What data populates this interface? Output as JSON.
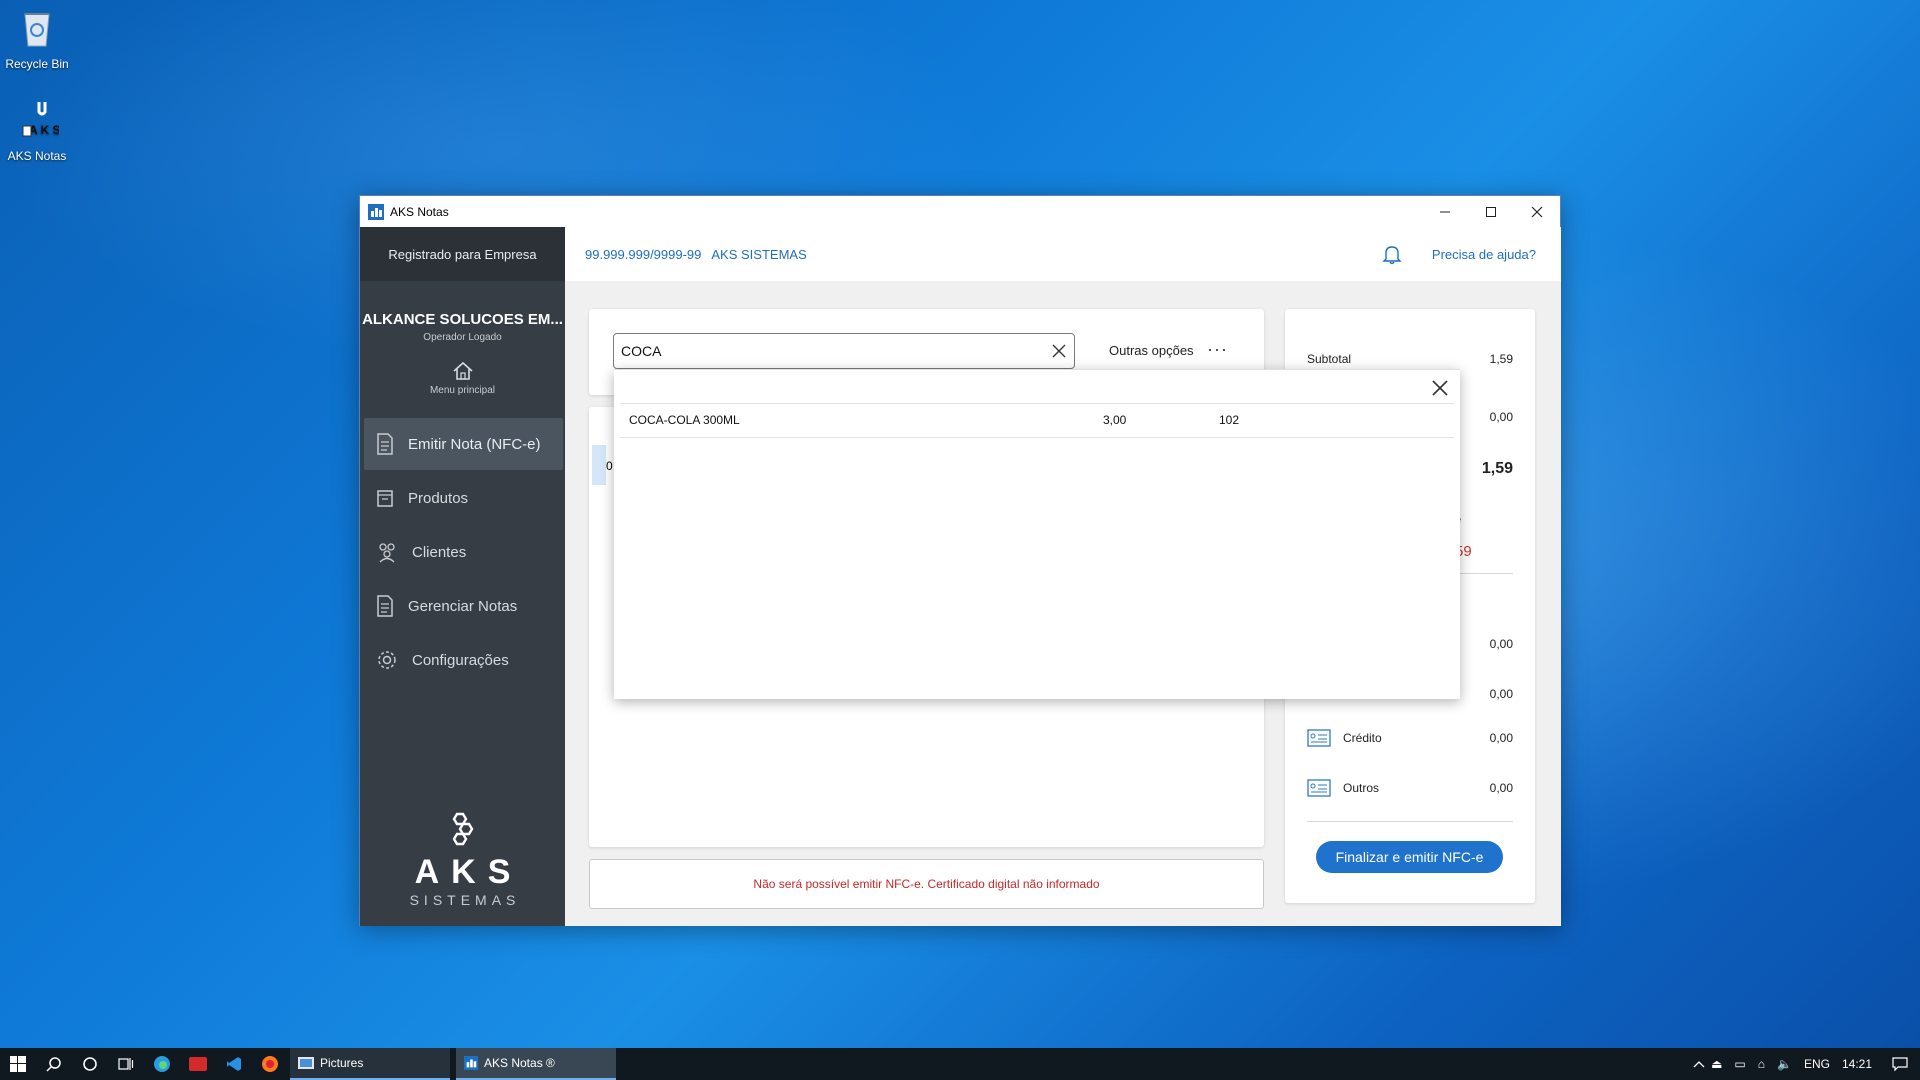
{
  "desktop": {
    "icons": [
      {
        "label": "Recycle Bin"
      },
      {
        "label": "AKS Notas"
      }
    ]
  },
  "window": {
    "title": "AKS Notas",
    "controls": {
      "minimize": "—",
      "maximize": "☐",
      "close": "✕"
    }
  },
  "sidebar": {
    "registered": "Registrado para Empresa",
    "company": "ALKANCE SOLUCOES EM...",
    "operator": "Operador Logado",
    "home": "Menu principal",
    "items": [
      {
        "label": "Emitir Nota (NFC-e)",
        "icon": "document-icon",
        "active": true
      },
      {
        "label": "Produtos",
        "icon": "box-icon"
      },
      {
        "label": "Clientes",
        "icon": "people-icon"
      },
      {
        "label": "Gerenciar Notas",
        "icon": "document-icon"
      },
      {
        "label": "Configurações",
        "icon": "gear-icon"
      }
    ],
    "logo": {
      "name": "AKS",
      "sub": "SISTEMAS"
    }
  },
  "topbar": {
    "cnpj": "99.999.999/9999-99",
    "firm": "AKS SISTEMAS",
    "help": "Precisa de ajuda?"
  },
  "search": {
    "value": "COCA",
    "other_options": "Outras opções",
    "more": "···"
  },
  "items_fragment": "0",
  "warning": "Não será possível emitir NFC-e. Certificado digital não informado",
  "summary": {
    "subtotal_label": "Subtotal",
    "subtotal": "1,59",
    "discount": "0,00",
    "total": "1,59",
    "partial_label": "e",
    "partial_value": "59",
    "payments": [
      {
        "label": "",
        "value": "0,00"
      },
      {
        "label": "",
        "value": "0,00"
      },
      {
        "label": "Crédito",
        "value": "0,00"
      },
      {
        "label": "Outros",
        "value": "0,00"
      }
    ],
    "finish_button": "Finalizar e emitir NFC-e"
  },
  "popup": {
    "results": [
      {
        "name": "COCA-COLA 300ML",
        "price": "3,00",
        "stock": "102"
      }
    ]
  },
  "taskbar": {
    "tasks": [
      {
        "label": "Pictures"
      },
      {
        "label": "AKS Notas ®"
      }
    ],
    "lang": "ENG",
    "time": "14:21"
  }
}
